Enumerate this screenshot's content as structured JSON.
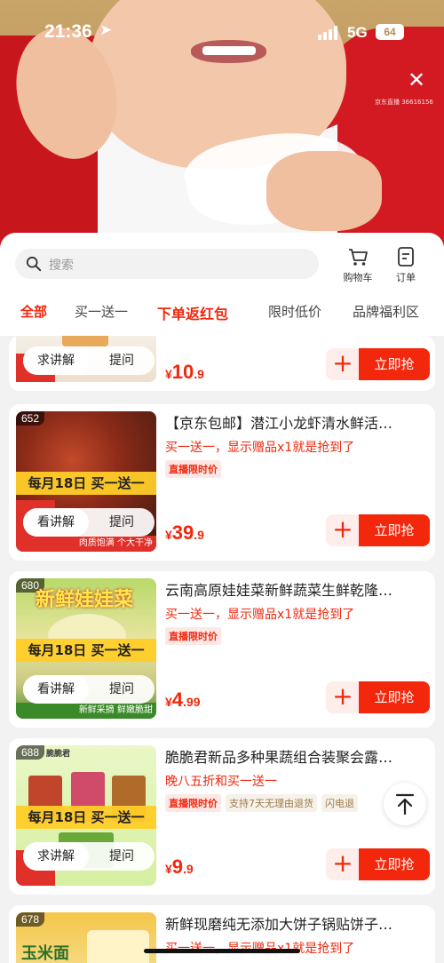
{
  "status": {
    "time": "21:36",
    "network": "5G",
    "battery": "64"
  },
  "video": {
    "watermark": "京东直播 36616156"
  },
  "panel": {
    "search_placeholder": "搜索",
    "cart_label": "购物车",
    "orders_label": "订单",
    "tabs": [
      "全部",
      "买一送一",
      "下单返红包",
      "限时低价",
      "品牌福利区"
    ]
  },
  "products": [
    {
      "price_int": "10",
      "price_dec": ".9",
      "btn_explain": "求讲解",
      "btn_ask": "提问",
      "buy_label": "立即抢"
    },
    {
      "rank": "652",
      "title": "【京东包邮】潜江小龙虾清水鲜活…",
      "subtitle": "买一送一，显示赠品x1就是抢到了",
      "tags": [
        "直播限时价"
      ],
      "promo": "每月18日 买一送一",
      "thumb_foot": "肉质饱满 个大干净",
      "price_int": "39",
      "price_dec": ".9",
      "btn_explain": "看讲解",
      "btn_ask": "提问",
      "buy_label": "立即抢"
    },
    {
      "rank": "680",
      "title": "云南高原娃娃菜新鲜蔬菜生鲜乾隆…",
      "subtitle": "买一送一，显示赠品x1就是抢到了",
      "tags": [
        "直播限时价"
      ],
      "thumb_title": "新鲜娃娃菜",
      "promo": "每月18日 买一送一",
      "thumb_foot": "新鲜采摘 鲜嫩脆甜",
      "price_int": "4",
      "price_dec": ".99",
      "btn_explain": "看讲解",
      "btn_ask": "提问",
      "buy_label": "立即抢"
    },
    {
      "rank": "688",
      "title": "脆脆君新品多种果蔬组合装聚会露…",
      "subtitle": "晚八五折和买一送一",
      "tags": [
        "直播限时价",
        "支持7天无理由退货",
        "闪电退"
      ],
      "brand": "脆脆君",
      "promo": "每月18日 买一送一",
      "price_int": "9",
      "price_dec": ".9",
      "btn_explain": "求讲解",
      "btn_ask": "提问",
      "buy_label": "立即抢"
    },
    {
      "rank": "678",
      "title": "新鲜现磨纯无添加大饼子锅贴饼子…",
      "subtitle": "买一送一，显示赠品x1就是抢到了",
      "thumb_title": "玉米面"
    }
  ],
  "colors": {
    "accent": "#f2270c",
    "promo_yellow": "#ffcd28"
  }
}
